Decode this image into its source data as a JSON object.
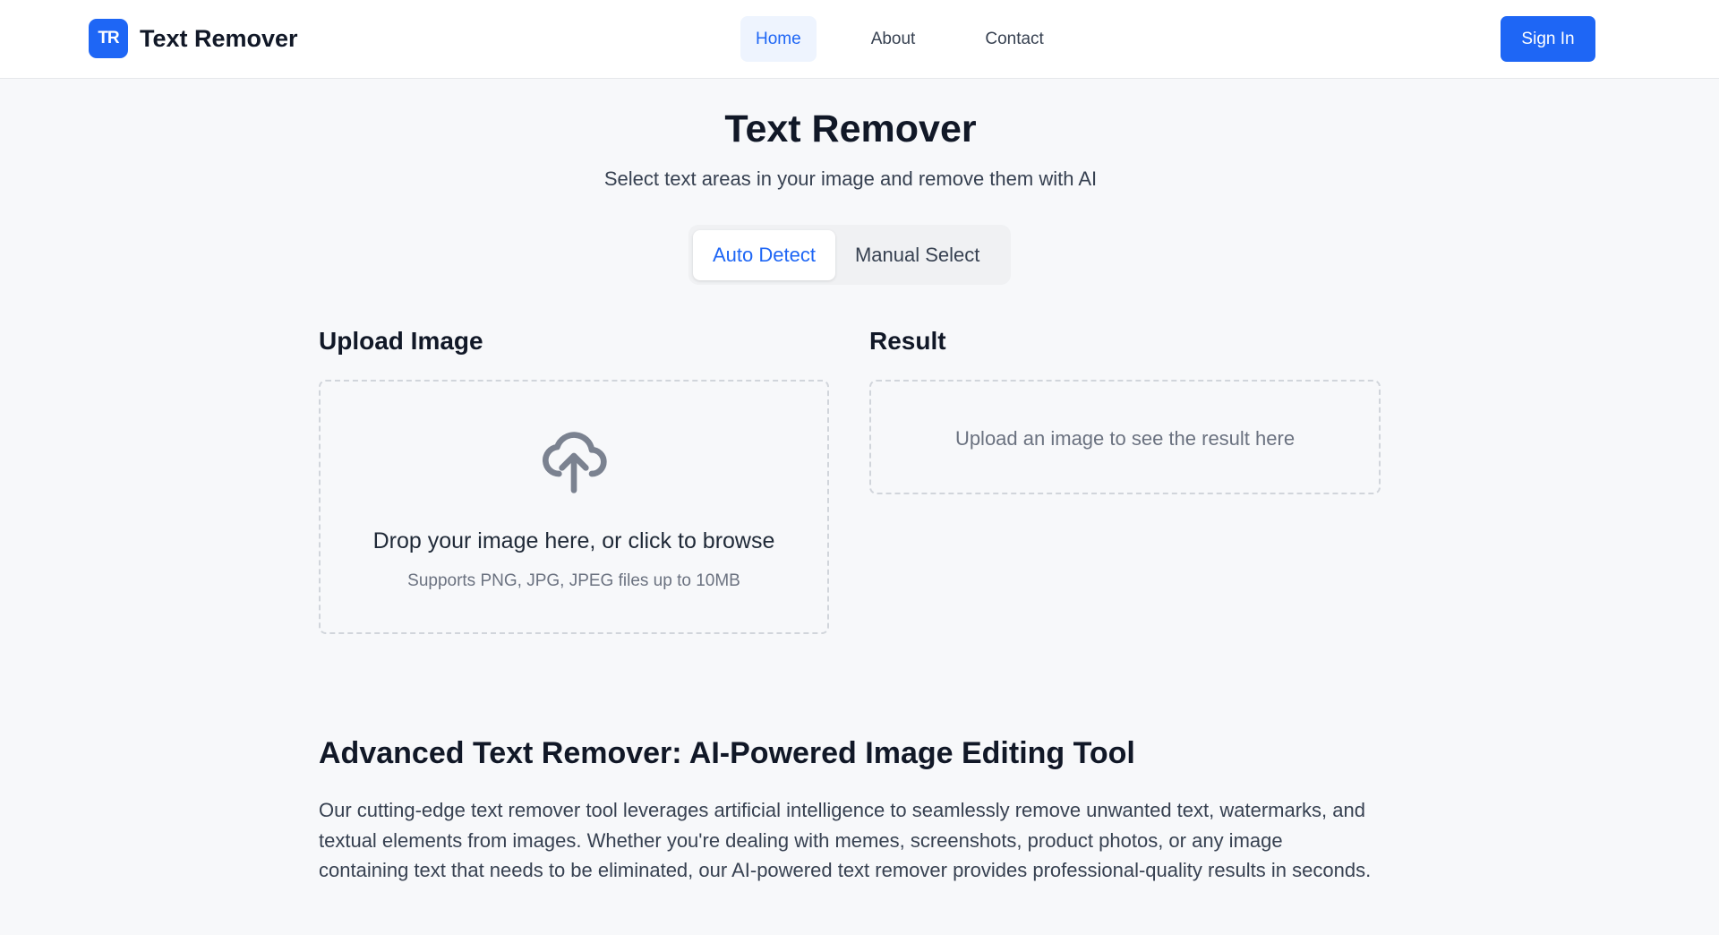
{
  "brand": {
    "logo_text": "TR",
    "name": "Text Remover"
  },
  "nav": {
    "items": [
      {
        "label": "Home",
        "active": true
      },
      {
        "label": "About",
        "active": false
      },
      {
        "label": "Contact",
        "active": false
      }
    ],
    "signin_label": "Sign In"
  },
  "hero": {
    "title": "Text Remover",
    "subtitle": "Select text areas in your image and remove them with AI"
  },
  "mode": {
    "options": [
      {
        "label": "Auto Detect",
        "active": true
      },
      {
        "label": "Manual Select",
        "active": false
      }
    ]
  },
  "upload": {
    "title": "Upload Image",
    "icon": "cloud-upload-icon",
    "drop_text": "Drop your image here, or click to browse",
    "hint": "Supports PNG, JPG, JPEG files up to 10MB"
  },
  "result": {
    "title": "Result",
    "placeholder": "Upload an image to see the result here"
  },
  "article": {
    "title": "Advanced Text Remover: AI-Powered Image Editing Tool",
    "body": "Our cutting-edge text remover tool leverages artificial intelligence to seamlessly remove unwanted text, watermarks, and textual elements from images. Whether you're dealing with memes, screenshots, product photos, or any image containing text that needs to be eliminated, our AI-powered text remover provides professional-quality results in seconds."
  },
  "colors": {
    "accent": "#1e66f5",
    "background": "#f7f8fa"
  }
}
